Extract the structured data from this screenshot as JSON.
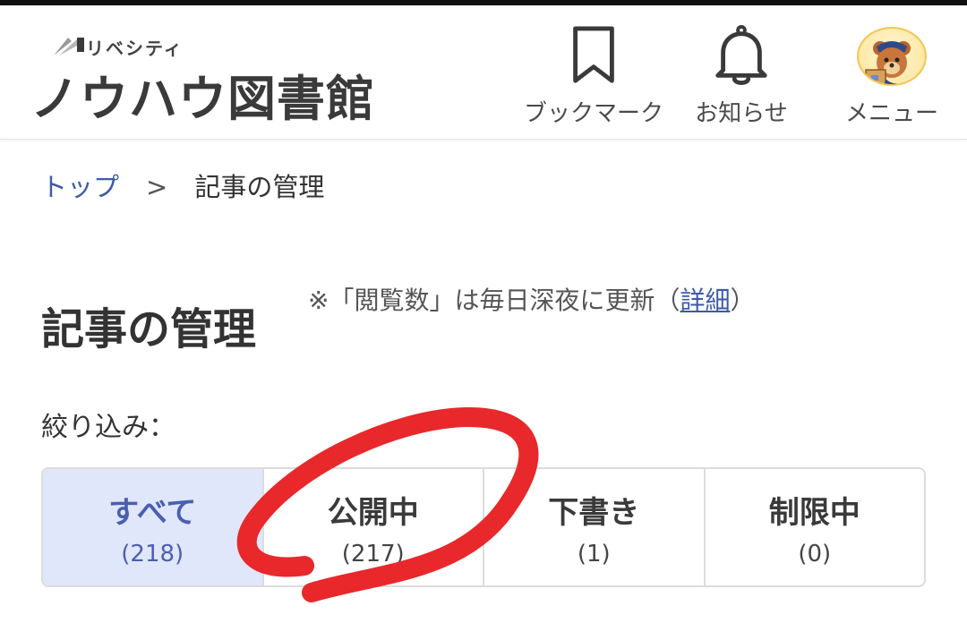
{
  "header": {
    "logo_sub": "リベシティ",
    "logo_main": "ノウハウ図書館",
    "nav": {
      "bookmark": "ブックマーク",
      "notice": "お知らせ",
      "menu": "メニュー"
    }
  },
  "breadcrumb": {
    "top": "トップ",
    "separator": ">",
    "current": "記事の管理"
  },
  "page": {
    "title": "記事の管理",
    "note_prefix": "※「閲覧数」は毎日深夜に更新（",
    "note_link": "詳細",
    "note_suffix": "）",
    "filter_label": "絞り込み："
  },
  "filters": [
    {
      "name": "すべて",
      "count": "(218)",
      "active": true
    },
    {
      "name": "公開中",
      "count": "(217)",
      "active": false
    },
    {
      "name": "下書き",
      "count": "(1)",
      "active": false
    },
    {
      "name": "制限中",
      "count": "(0)",
      "active": false
    }
  ],
  "colors": {
    "accent": "#3c5aa6",
    "active_tab_bg": "#e1e7fa",
    "annotation": "#e8282b"
  },
  "icons": {
    "bookmark": "bookmark-icon",
    "notice": "bell-icon",
    "menu": "avatar-bear"
  }
}
